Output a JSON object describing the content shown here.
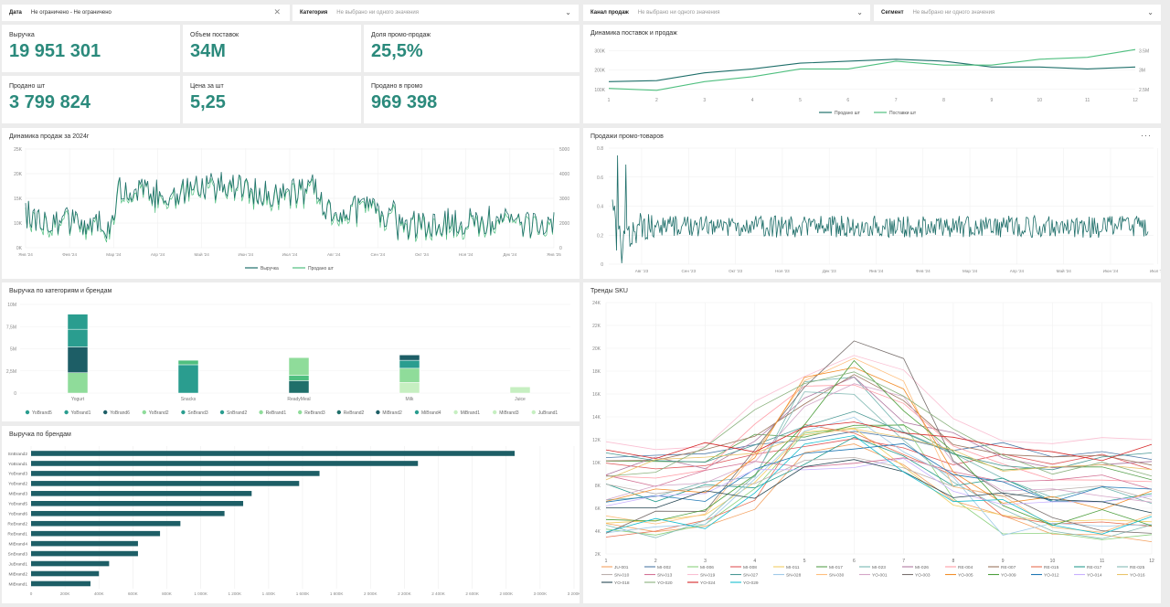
{
  "filters": [
    {
      "label": "Дата",
      "value": "Не ограничено - Не ограничено",
      "dark": true
    },
    {
      "label": "Категория",
      "value": "Не выбрано ни одного значения",
      "dark": false
    },
    {
      "label": "Канал продаж",
      "value": "Не выбрано ни одного значения",
      "dark": false
    },
    {
      "label": "Сегмент",
      "value": "Не выбрано ни одного значения",
      "dark": false
    }
  ],
  "kpis": [
    {
      "label": "Выручка",
      "value": "19 951 301"
    },
    {
      "label": "Объем поставок",
      "value": "34M"
    },
    {
      "label": "Доля промо-продаж",
      "value": "25,5%"
    },
    {
      "label": "Продано шт",
      "value": "3 799 824"
    },
    {
      "label": "Цена за шт",
      "value": "5,25"
    },
    {
      "label": "Продано в промо",
      "value": "969 398"
    }
  ],
  "colors": {
    "teal_dark": "#1f6f6a",
    "teal": "#2a9d8f",
    "green_mid": "#4fbf7f",
    "green_light": "#8fdc9a",
    "green_pale": "#c6efc1",
    "navy_teal": "#1d5e66"
  },
  "titles": {
    "supply": "Динамика поставок и продаж",
    "sales2024": "Динамика продаж за 2024г",
    "promo": "Продажи промо-товаров",
    "catbrand": "Выручка по категориям и брендам",
    "brands": "Выручка по брендам",
    "sku": "Тренды SKU"
  },
  "more_icon": "···",
  "chart_data": [
    {
      "id": "supply",
      "type": "line",
      "x": [
        "1",
        "2",
        "3",
        "4",
        "5",
        "6",
        "7",
        "8",
        "9",
        "10",
        "11",
        "12"
      ],
      "left_ticks": [
        "100K",
        "200K",
        "300K"
      ],
      "right_ticks": [
        "2.5M",
        "3M",
        "3.5M"
      ],
      "series": [
        {
          "name": "Продано шт",
          "values": [
            140,
            145,
            185,
            205,
            235,
            245,
            255,
            245,
            215,
            215,
            205,
            215
          ]
        },
        {
          "name": "Поставки шт",
          "values": [
            105,
            95,
            140,
            165,
            205,
            205,
            245,
            225,
            225,
            255,
            265,
            305
          ]
        }
      ]
    },
    {
      "id": "sales2024",
      "type": "line",
      "x_ticks": [
        "Янв '24",
        "Фев '24",
        "Мар '24",
        "Апр '24",
        "Май '24",
        "Июн '24",
        "Июл '24",
        "Авг '24",
        "Сен '24",
        "Окт '24",
        "Ноя '24",
        "Дек '24",
        "Янв '25"
      ],
      "left_ticks": [
        "0K",
        "10K",
        "15K",
        "20K",
        "25K"
      ],
      "right_ticks": [
        "0",
        "2000",
        "3000",
        "4000",
        "5000"
      ],
      "series": [
        {
          "name": "Выручка"
        },
        {
          "name": "Продано шт"
        }
      ]
    },
    {
      "id": "promo",
      "type": "line",
      "x_ticks": [
        "Авг '23",
        "Сен '23",
        "Окт '23",
        "Ноя '23",
        "Дек '23",
        "Янв '24",
        "Фев '24",
        "Мар '24",
        "Апр '24",
        "Май '24",
        "Июн '24",
        "Июл '24",
        "Авг '24"
      ],
      "y_ticks": [
        "0",
        "0.2",
        "0.4",
        "0.6",
        "0.8"
      ]
    },
    {
      "id": "catbrand",
      "type": "bar",
      "categories": [
        "Yogurt",
        "Snacks",
        "ReadyMeal",
        "Milk",
        "Juice"
      ],
      "y_ticks": [
        "0",
        "2,5M",
        "5M",
        "7,5M",
        "10M"
      ],
      "stacks": [
        [
          {
            "v": 2.3,
            "c": "green_light"
          },
          {
            "v": 2.9,
            "c": "navy_teal"
          },
          {
            "v": 2.0,
            "c": "teal"
          },
          {
            "v": 1.7,
            "c": "teal"
          }
        ],
        [
          {
            "v": 3.2,
            "c": "teal"
          },
          {
            "v": 0.5,
            "c": "green_mid"
          }
        ],
        [
          {
            "v": 1.4,
            "c": "teal_dark"
          },
          {
            "v": 0.6,
            "c": "green_mid"
          },
          {
            "v": 2.0,
            "c": "green_light"
          }
        ],
        [
          {
            "v": 1.2,
            "c": "green_pale"
          },
          {
            "v": 1.6,
            "c": "green_light"
          },
          {
            "v": 0.9,
            "c": "teal"
          },
          {
            "v": 0.6,
            "c": "navy_teal"
          }
        ],
        [
          {
            "v": 0.7,
            "c": "green_pale"
          }
        ]
      ],
      "legend": [
        {
          "name": "YoBrand5",
          "c": "teal"
        },
        {
          "name": "YoBrand1",
          "c": "teal"
        },
        {
          "name": "YoBrand6",
          "c": "navy_teal"
        },
        {
          "name": "YoBrand2",
          "c": "green_light"
        },
        {
          "name": "SnBrand3",
          "c": "teal"
        },
        {
          "name": "SnBrand2",
          "c": "teal"
        },
        {
          "name": "ReBrand1",
          "c": "green_light"
        },
        {
          "name": "ReBrand3",
          "c": "green_light"
        },
        {
          "name": "ReBrand2",
          "c": "teal_dark"
        },
        {
          "name": "MiBrand2",
          "c": "navy_teal"
        },
        {
          "name": "MiBrand4",
          "c": "teal"
        },
        {
          "name": "MiBrand1",
          "c": "green_pale"
        },
        {
          "name": "MiBrand3",
          "c": "green_pale"
        },
        {
          "name": "JuBrand1",
          "c": "green_pale"
        }
      ]
    },
    {
      "id": "brands",
      "type": "bar",
      "categories": [
        "SnBrand2",
        "YoBrand1",
        "YoBrand3",
        "YoBrand2",
        "MiBrand3",
        "YoBrand5",
        "YoBrand6",
        "ReBrand2",
        "ReBrand1",
        "MiBrand4",
        "SnBrand3",
        "JuBrand1",
        "MiBrand2",
        "MiBrand1"
      ],
      "values": [
        2850000,
        2280000,
        1700000,
        1580000,
        1300000,
        1250000,
        1140000,
        880000,
        760000,
        630000,
        630000,
        460000,
        400000,
        350000
      ],
      "x_ticks": [
        "0",
        "200K",
        "400K",
        "600K",
        "800K",
        "1 000K",
        "1 200K",
        "1 400K",
        "1 600K",
        "1 800K",
        "2 000K",
        "2 200K",
        "2 400K",
        "2 600K",
        "2 800K",
        "3 000K",
        "3 200K"
      ]
    },
    {
      "id": "sku",
      "type": "line",
      "x": [
        "1",
        "2",
        "3",
        "4",
        "5",
        "6",
        "7",
        "8",
        "9",
        "10",
        "11",
        "12"
      ],
      "y_ticks": [
        "2K",
        "4K",
        "6K",
        "8K",
        "10K",
        "12K",
        "14K",
        "16K",
        "18K",
        "20K",
        "22K",
        "24K"
      ],
      "series_names": [
        "JU-001",
        "MI-002",
        "MI-006",
        "MI-008",
        "MI-011",
        "MI-017",
        "MI-023",
        "MI-026",
        "RE-004",
        "RE-007",
        "RE-015",
        "RE-017",
        "RE-025",
        "SN-010",
        "SN-013",
        "SN-019",
        "SN-027",
        "SN-028",
        "SN-030",
        "YO-001",
        "YO-003",
        "YO-005",
        "YO-009",
        "YO-012",
        "YO-014",
        "YO-016",
        "YO-018",
        "YO-020",
        "YO-024",
        "YO-029"
      ]
    }
  ]
}
